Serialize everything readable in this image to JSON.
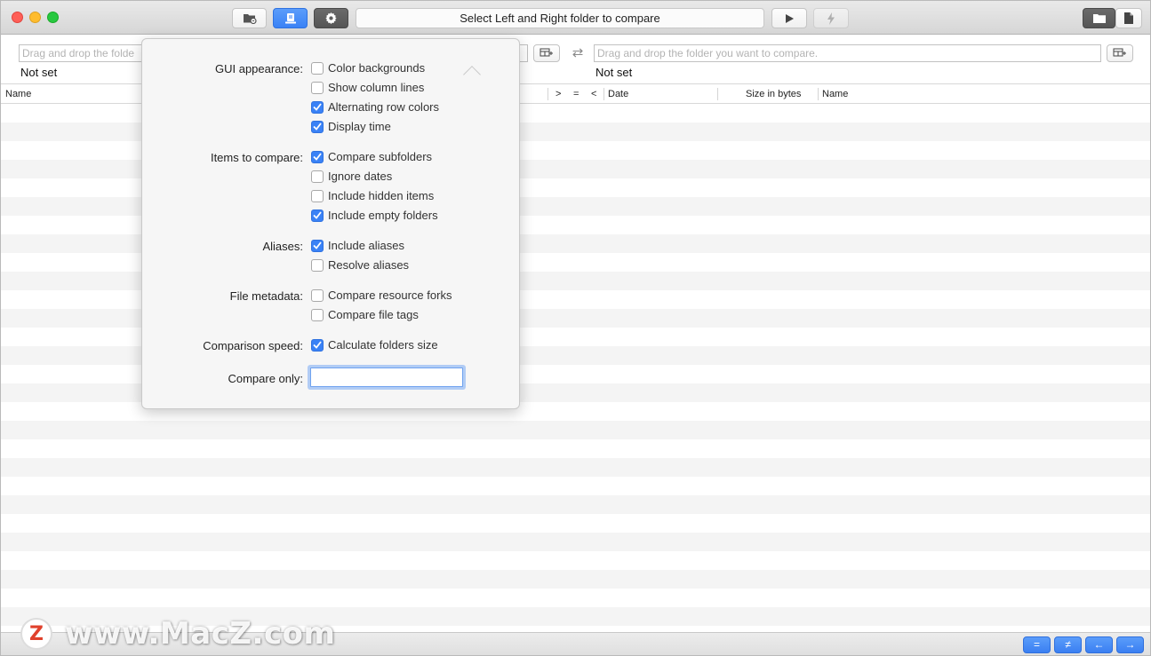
{
  "window": {
    "status": "Select Left and Right folder to compare"
  },
  "left": {
    "placeholder": "Drag and drop the folder you want to compare.",
    "visible_placeholder": "Drag and drop the folde",
    "path_label": "Not set"
  },
  "right": {
    "placeholder": "Drag and drop the folder you want to compare.",
    "path_label": "Not set"
  },
  "columns": {
    "left_name": "Name",
    "gt": ">",
    "eq": "=",
    "lt": "<",
    "date": "Date",
    "size": "Size in bytes",
    "right_name": "Name"
  },
  "popover": {
    "sections": {
      "gui": "GUI appearance:",
      "items": "Items to compare:",
      "aliases": "Aliases:",
      "metadata": "File metadata:",
      "speed": "Comparison speed:",
      "compare_only": "Compare only:"
    },
    "options": [
      {
        "label": "Color backgrounds",
        "checked": false
      },
      {
        "label": "Show column lines",
        "checked": false
      },
      {
        "label": "Alternating row colors",
        "checked": true
      },
      {
        "label": "Display time",
        "checked": true
      },
      {
        "label": "Compare subfolders",
        "checked": true
      },
      {
        "label": "Ignore dates",
        "checked": false
      },
      {
        "label": "Include hidden items",
        "checked": false
      },
      {
        "label": "Include empty folders",
        "checked": true
      },
      {
        "label": "Include aliases",
        "checked": true
      },
      {
        "label": "Resolve aliases",
        "checked": false
      },
      {
        "label": "Compare resource forks",
        "checked": false
      },
      {
        "label": "Compare file tags",
        "checked": false
      },
      {
        "label": "Calculate folders size",
        "checked": true
      }
    ],
    "compare_only_value": ""
  },
  "bottom": {
    "equal_label": "=",
    "notequal_label": "≠",
    "left_label": "←",
    "right_label": "→"
  },
  "watermark": {
    "logo": "Z",
    "text": "www.MacZ.com"
  },
  "colors": {
    "accent": "#3a82f6",
    "row_alt": "#f4f4f4"
  }
}
